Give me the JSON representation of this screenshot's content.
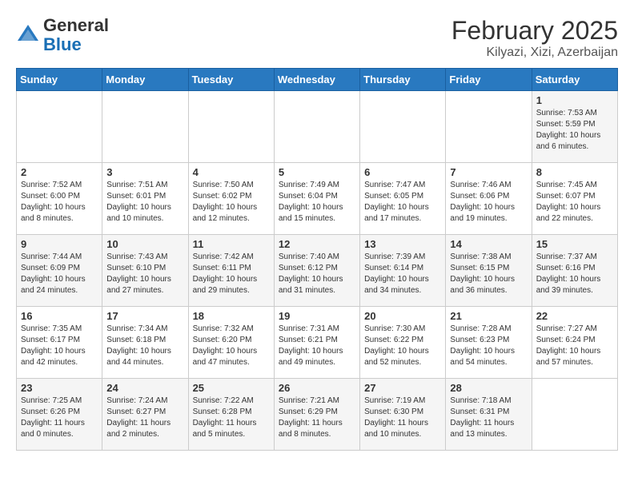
{
  "header": {
    "logo_general": "General",
    "logo_blue": "Blue",
    "month_year": "February 2025",
    "location": "Kilyazi, Xizi, Azerbaijan"
  },
  "days_of_week": [
    "Sunday",
    "Monday",
    "Tuesday",
    "Wednesday",
    "Thursday",
    "Friday",
    "Saturday"
  ],
  "weeks": [
    [
      {
        "day": "",
        "detail": ""
      },
      {
        "day": "",
        "detail": ""
      },
      {
        "day": "",
        "detail": ""
      },
      {
        "day": "",
        "detail": ""
      },
      {
        "day": "",
        "detail": ""
      },
      {
        "day": "",
        "detail": ""
      },
      {
        "day": "1",
        "detail": "Sunrise: 7:53 AM\nSunset: 5:59 PM\nDaylight: 10 hours\nand 6 minutes."
      }
    ],
    [
      {
        "day": "2",
        "detail": "Sunrise: 7:52 AM\nSunset: 6:00 PM\nDaylight: 10 hours\nand 8 minutes."
      },
      {
        "day": "3",
        "detail": "Sunrise: 7:51 AM\nSunset: 6:01 PM\nDaylight: 10 hours\nand 10 minutes."
      },
      {
        "day": "4",
        "detail": "Sunrise: 7:50 AM\nSunset: 6:02 PM\nDaylight: 10 hours\nand 12 minutes."
      },
      {
        "day": "5",
        "detail": "Sunrise: 7:49 AM\nSunset: 6:04 PM\nDaylight: 10 hours\nand 15 minutes."
      },
      {
        "day": "6",
        "detail": "Sunrise: 7:47 AM\nSunset: 6:05 PM\nDaylight: 10 hours\nand 17 minutes."
      },
      {
        "day": "7",
        "detail": "Sunrise: 7:46 AM\nSunset: 6:06 PM\nDaylight: 10 hours\nand 19 minutes."
      },
      {
        "day": "8",
        "detail": "Sunrise: 7:45 AM\nSunset: 6:07 PM\nDaylight: 10 hours\nand 22 minutes."
      }
    ],
    [
      {
        "day": "9",
        "detail": "Sunrise: 7:44 AM\nSunset: 6:09 PM\nDaylight: 10 hours\nand 24 minutes."
      },
      {
        "day": "10",
        "detail": "Sunrise: 7:43 AM\nSunset: 6:10 PM\nDaylight: 10 hours\nand 27 minutes."
      },
      {
        "day": "11",
        "detail": "Sunrise: 7:42 AM\nSunset: 6:11 PM\nDaylight: 10 hours\nand 29 minutes."
      },
      {
        "day": "12",
        "detail": "Sunrise: 7:40 AM\nSunset: 6:12 PM\nDaylight: 10 hours\nand 31 minutes."
      },
      {
        "day": "13",
        "detail": "Sunrise: 7:39 AM\nSunset: 6:14 PM\nDaylight: 10 hours\nand 34 minutes."
      },
      {
        "day": "14",
        "detail": "Sunrise: 7:38 AM\nSunset: 6:15 PM\nDaylight: 10 hours\nand 36 minutes."
      },
      {
        "day": "15",
        "detail": "Sunrise: 7:37 AM\nSunset: 6:16 PM\nDaylight: 10 hours\nand 39 minutes."
      }
    ],
    [
      {
        "day": "16",
        "detail": "Sunrise: 7:35 AM\nSunset: 6:17 PM\nDaylight: 10 hours\nand 42 minutes."
      },
      {
        "day": "17",
        "detail": "Sunrise: 7:34 AM\nSunset: 6:18 PM\nDaylight: 10 hours\nand 44 minutes."
      },
      {
        "day": "18",
        "detail": "Sunrise: 7:32 AM\nSunset: 6:20 PM\nDaylight: 10 hours\nand 47 minutes."
      },
      {
        "day": "19",
        "detail": "Sunrise: 7:31 AM\nSunset: 6:21 PM\nDaylight: 10 hours\nand 49 minutes."
      },
      {
        "day": "20",
        "detail": "Sunrise: 7:30 AM\nSunset: 6:22 PM\nDaylight: 10 hours\nand 52 minutes."
      },
      {
        "day": "21",
        "detail": "Sunrise: 7:28 AM\nSunset: 6:23 PM\nDaylight: 10 hours\nand 54 minutes."
      },
      {
        "day": "22",
        "detail": "Sunrise: 7:27 AM\nSunset: 6:24 PM\nDaylight: 10 hours\nand 57 minutes."
      }
    ],
    [
      {
        "day": "23",
        "detail": "Sunrise: 7:25 AM\nSunset: 6:26 PM\nDaylight: 11 hours\nand 0 minutes."
      },
      {
        "day": "24",
        "detail": "Sunrise: 7:24 AM\nSunset: 6:27 PM\nDaylight: 11 hours\nand 2 minutes."
      },
      {
        "day": "25",
        "detail": "Sunrise: 7:22 AM\nSunset: 6:28 PM\nDaylight: 11 hours\nand 5 minutes."
      },
      {
        "day": "26",
        "detail": "Sunrise: 7:21 AM\nSunset: 6:29 PM\nDaylight: 11 hours\nand 8 minutes."
      },
      {
        "day": "27",
        "detail": "Sunrise: 7:19 AM\nSunset: 6:30 PM\nDaylight: 11 hours\nand 10 minutes."
      },
      {
        "day": "28",
        "detail": "Sunrise: 7:18 AM\nSunset: 6:31 PM\nDaylight: 11 hours\nand 13 minutes."
      },
      {
        "day": "",
        "detail": ""
      }
    ]
  ]
}
